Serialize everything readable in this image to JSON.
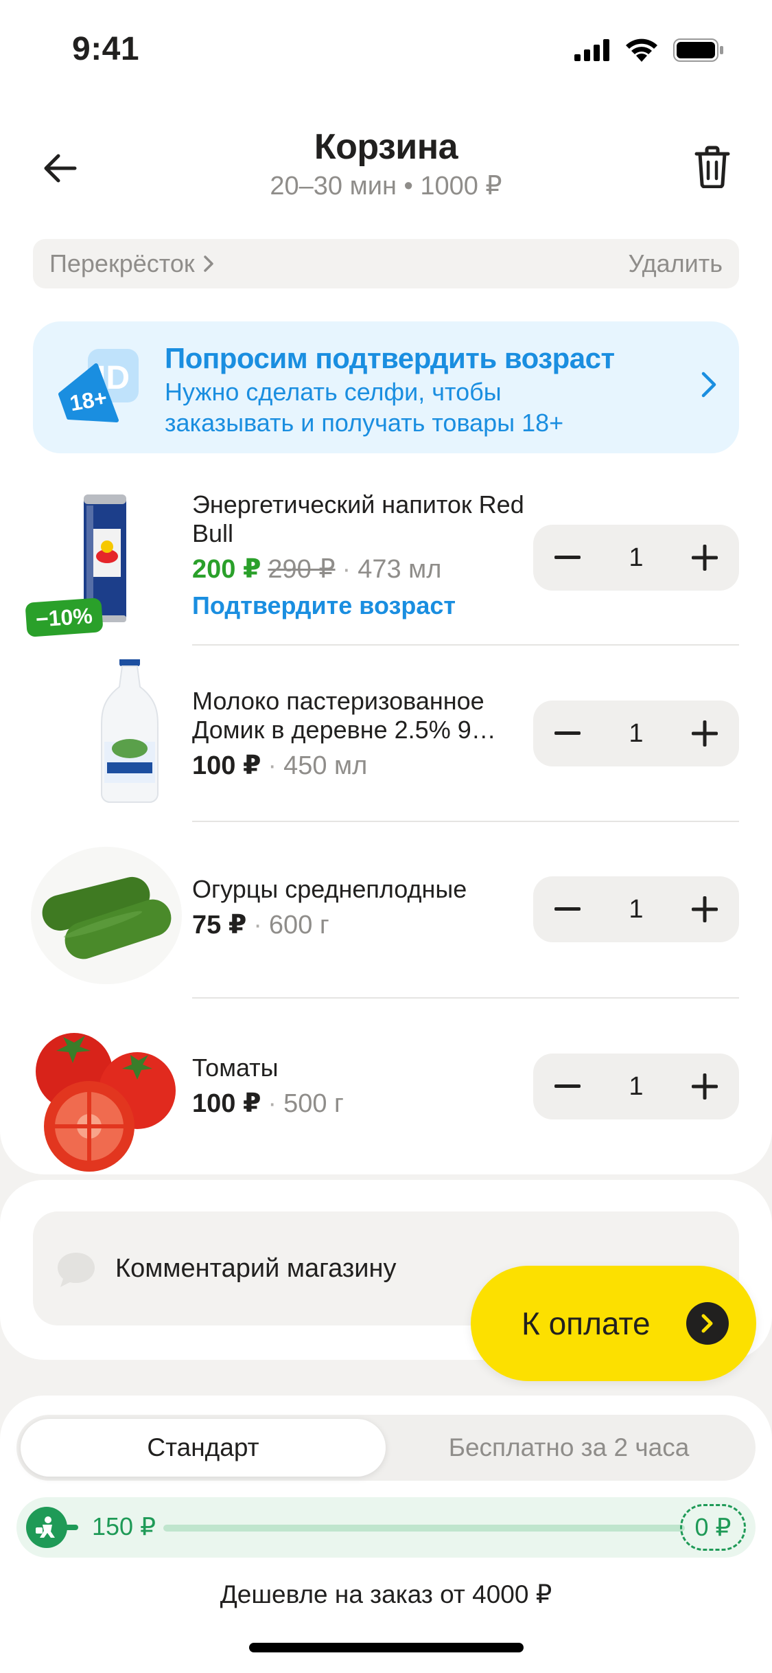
{
  "status_bar": {
    "time": "9:41"
  },
  "header": {
    "title": "Корзина",
    "subtitle": "20–30 мин • 1000 ₽"
  },
  "store": {
    "name": "Перекрёсток",
    "remove_label": "Удалить"
  },
  "age_banner": {
    "badge": "18+",
    "id_text": "ID",
    "title": "Попросим подтвердить возраст",
    "text": "Нужно сделать селфи, чтобы заказывать и получать товары 18+"
  },
  "products": [
    {
      "name": "Энергетический напиток Red Bull",
      "price": "200 ₽",
      "old_price": "290 ₽",
      "volume": "473 мл",
      "confirm": "Подтвердите возраст",
      "discount": "−10%",
      "quantity": "1",
      "image": "red-bull-can"
    },
    {
      "name": "Молоко пастеризованное Домик в деревне 2.5% 9…",
      "price": "100 ₽",
      "volume": "450 мл",
      "quantity": "1",
      "image": "milk-bottle"
    },
    {
      "name": "Огурцы среднеплодные",
      "price": "75 ₽",
      "volume": "600 г",
      "quantity": "1",
      "image": "cucumbers"
    },
    {
      "name": "Томаты",
      "price": "100 ₽",
      "volume": "500 г",
      "quantity": "1",
      "image": "tomatoes"
    }
  ],
  "comment": {
    "label": "Комментарий магазину"
  },
  "pay_button": {
    "label": "К оплате"
  },
  "delivery": {
    "tabs": [
      "Стандарт",
      "Бесплатно за 2 часа"
    ],
    "active_tab": "Стандарт",
    "progress_start": "150 ₽",
    "progress_end": "0 ₽",
    "progress_fraction": 0,
    "note": "Дешевле на заказ от 4000 ₽"
  },
  "colors": {
    "accent_yellow": "#fce000",
    "link_blue": "#1a8ee0",
    "sale_green": "#2aa02a",
    "progress_green": "#1f9a57"
  }
}
